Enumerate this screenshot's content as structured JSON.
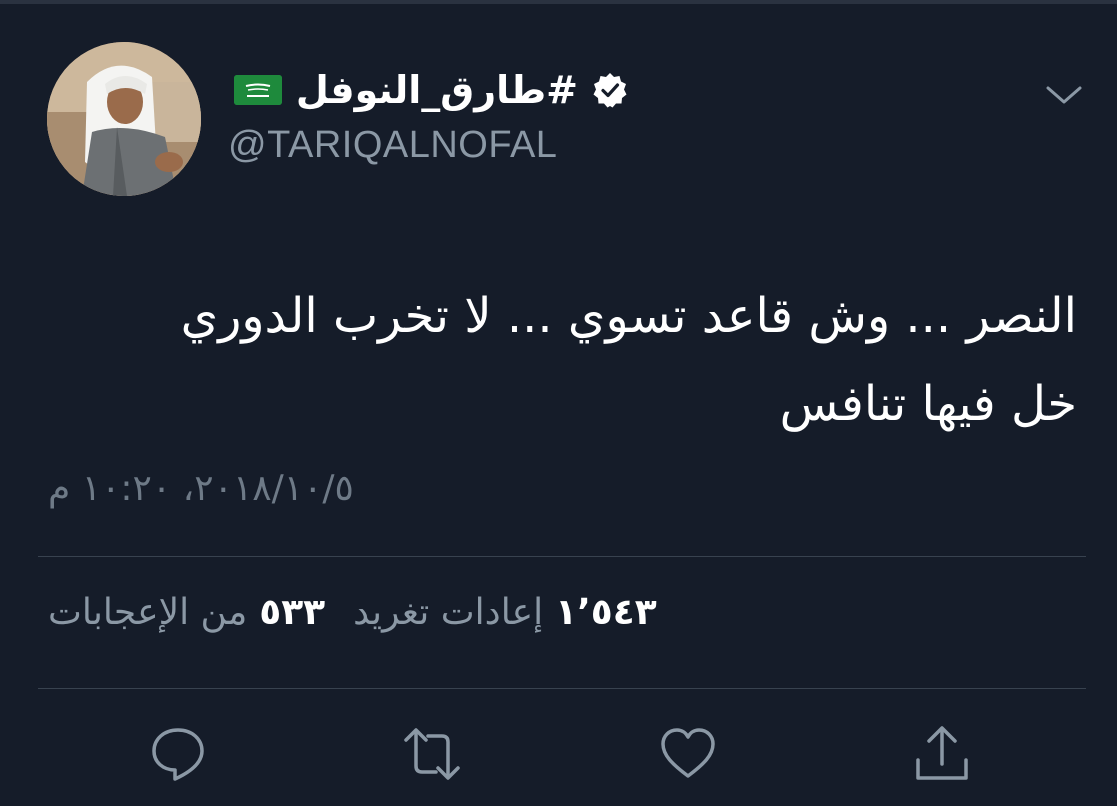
{
  "tweet": {
    "display_name": "#طارق_النوفل",
    "handle": "@TARIQALNOFAL",
    "text_lines": [
      "النصر ... وش قاعد تسوي ... لا تخرب الدوري",
      "خل فيها تنافس"
    ],
    "timestamp": "٢٠١٨/١٠/٥، ١٠:٢٠ م"
  },
  "stats": {
    "retweets_count": "١٬٥٤٣",
    "retweets_label": "إعادات تغريد",
    "likes_count": "٥٣٣",
    "likes_label": "من الإعجابات"
  },
  "icons": {
    "verified": "verified-badge-icon",
    "flag": "saudi-flag-icon",
    "caret": "chevron-down-icon",
    "reply": "reply-icon",
    "retweet": "retweet-icon",
    "like": "heart-icon",
    "share": "share-icon"
  },
  "colors": {
    "background": "#151c29",
    "secondary_text": "#8b98a5",
    "flag_green": "#1e8a3c"
  }
}
